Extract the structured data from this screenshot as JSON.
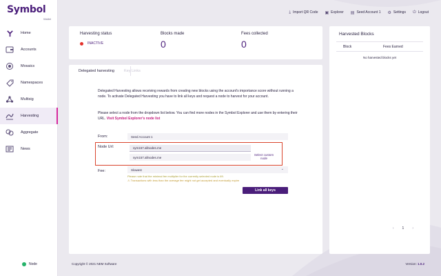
{
  "app": {
    "logo_text": "Symbol",
    "logo_sub": "Wallet"
  },
  "sidebar": {
    "items": [
      {
        "label": "Home",
        "icon": "home-icon"
      },
      {
        "label": "Accounts",
        "icon": "wallet-icon"
      },
      {
        "label": "Mosaics",
        "icon": "mosaic-icon"
      },
      {
        "label": "Namespaces",
        "icon": "namespace-icon"
      },
      {
        "label": "Multisig",
        "icon": "multisig-icon"
      },
      {
        "label": "Harvesting",
        "icon": "harvest-icon",
        "active": true
      },
      {
        "label": "Aggregate",
        "icon": "aggregate-icon"
      },
      {
        "label": "News",
        "icon": "news-icon"
      }
    ],
    "node_label": "Node"
  },
  "topbar": {
    "import_qr": "Import QR Code",
    "explorer": "Explorer",
    "account": "Seed Account 1",
    "settings": "Settings",
    "logout": "Logout"
  },
  "status": {
    "harvesting_status_label": "Harvesting status",
    "harvesting_status_value": "INACTIVE",
    "blocks_made_label": "Blocks made",
    "blocks_made_value": "0",
    "fees_collected_label": "Fees collected",
    "fees_collected_value": "0"
  },
  "tabs": {
    "delegated": "Delegated harvesting",
    "keylinks": "Key Links"
  },
  "description": {
    "para1": "Delegated Harvesting allows receiving rewards from creating new blocks using the account's importance score without running a node. To activate Delegated Harvesting you have to link all keys and request a node to harvest for your account.",
    "para2": "Please select a node from the dropdown list below. You can find more nodes in the Symbol Explorer and use them by entering their URL.",
    "link": "Visit Symbol Explorer's node list"
  },
  "form": {
    "from_label": "From:",
    "from_value": "Seed Account 1",
    "node_url_label": "Node Url:",
    "node_url_value": "sym157.allnodes.me",
    "node_option": "sym157.allnodes.me",
    "select_custom": "Select custom node",
    "fee_label": "Fee:",
    "fee_value": "Slowest",
    "fee_note1": "Please note that the minimal fee multiplier for the currently selected node is 69.",
    "fee_note2": "⚠ Transactions with less than the average fee might not get accepted and eventually expire",
    "link_all_keys": "Link all keys"
  },
  "harvested_blocks": {
    "title": "Harvested Blocks",
    "col_block": "Block",
    "col_fees": "Fees Earned",
    "empty": "No harvested blocks yet",
    "page": "1",
    "prev": "‹",
    "next": "›"
  },
  "footer": {
    "copyright": "Copyright © 2021 NEM Software",
    "version_label": "Version:",
    "version_value": "1.0.2"
  },
  "colors": {
    "brand": "#4a1d7a",
    "accent": "#d6279d",
    "status_inactive": "#e4312b",
    "node_ok": "#26b36a"
  }
}
